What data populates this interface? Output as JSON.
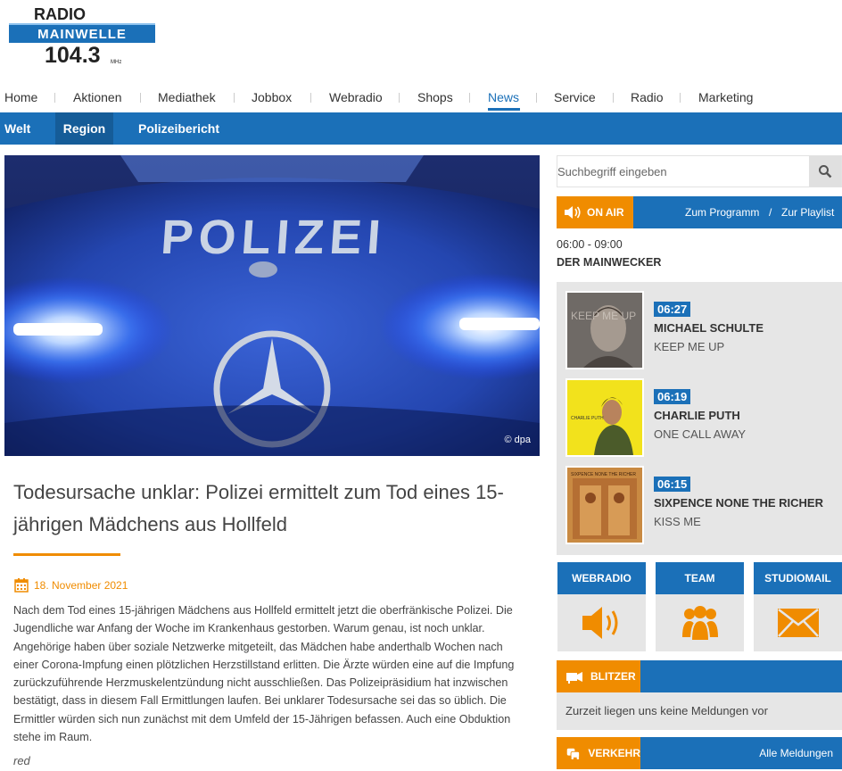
{
  "logo": {
    "line1": "RADIO",
    "line2": "MAINWELLE",
    "line3": "104.3",
    "unit": "MHz"
  },
  "nav": {
    "items": [
      "Home",
      "Aktionen",
      "Mediathek",
      "Jobbox",
      "Webradio",
      "Shops",
      "News",
      "Service",
      "Radio",
      "Marketing"
    ],
    "active": "News"
  },
  "subnav": {
    "items": [
      "Welt",
      "Region",
      "Polizeibericht"
    ],
    "active": "Region"
  },
  "hero": {
    "plate_text": "POLIZEI",
    "credit": "© dpa"
  },
  "article": {
    "headline": "Todesursache unklar: Polizei ermittelt zum Tod eines 15-jährigen Mädchens aus Hollfeld",
    "date": "18. November 2021",
    "body": "Nach dem Tod eines 15-jährigen Mädchens aus Hollfeld ermittelt jetzt die oberfränkische Polizei. Die Jugendliche war Anfang der Woche im Krankenhaus gestorben. Warum genau, ist noch unklar. Angehörige haben über soziale Netzwerke mitgeteilt, das Mädchen habe anderthalb Wochen nach einer Corona-Impfung einen plötzlichen Herzstillstand erlitten. Die Ärzte würden eine auf die Impfung zurückzuführende Herzmuskelentzündung nicht ausschließen. Das Polizeipräsidium hat inzwischen bestätigt, dass in diesem Fall Ermittlungen laufen. Bei unklarer Todesursache sei das so üblich. Die Ermittler würden sich nun zunächst mit dem Umfeld der 15-Jährigen befassen. Auch eine Obduktion stehe im Raum.",
    "author": "red"
  },
  "search": {
    "placeholder": "Suchbegriff eingeben"
  },
  "onair": {
    "label": "ON AIR",
    "program_link": "Zum Programm",
    "separator": "/",
    "playlist_link": "Zur Playlist",
    "show_time": "06:00 - 09:00",
    "show_name": "DER MAINWECKER"
  },
  "tracks": [
    {
      "time": "06:27",
      "artist": "MICHAEL SCHULTE",
      "title": "KEEP ME UP",
      "cover_text": "KEEP ME UP"
    },
    {
      "time": "06:19",
      "artist": "CHARLIE PUTH",
      "title": "ONE CALL AWAY",
      "cover_text": "CHARLIE PUTH"
    },
    {
      "time": "06:15",
      "artist": "SIXPENCE NONE THE RICHER",
      "title": "KISS ME",
      "cover_text": "SIXPENCE NONE THE RICHER"
    }
  ],
  "tiles": [
    "WEBRADIO",
    "TEAM",
    "STUDIOMAIL"
  ],
  "blitzer": {
    "label": "BLITZER",
    "message": "Zurzeit liegen uns keine Meldungen vor"
  },
  "verkehr": {
    "label": "VERKEHR",
    "link": "Alle Meldungen"
  },
  "colors": {
    "brand_blue": "#1b70b8",
    "accent_orange": "#f08c00",
    "panel_grey": "#e6e6e6"
  }
}
